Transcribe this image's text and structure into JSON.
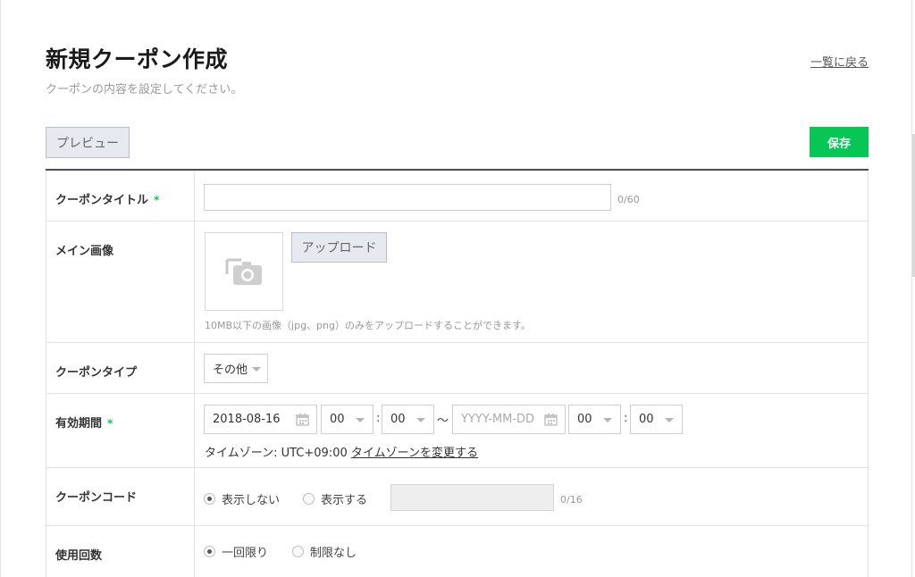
{
  "header": {
    "title": "新規クーポン作成",
    "subtitle": "クーポンの内容を設定してください。",
    "back_link": "一覧に戻る"
  },
  "toolbar": {
    "preview_label": "プレビュー",
    "save_label": "保存"
  },
  "form": {
    "title_row": {
      "label": "クーポンタイトル",
      "required_mark": "*",
      "value": "",
      "counter": "0/60"
    },
    "image_row": {
      "label": "メイン画像",
      "upload_label": "アップロード",
      "note": "10MB以下の画像（jpg、png）のみをアップロードすることができます。",
      "icon": "camera-icon"
    },
    "type_row": {
      "label": "クーポンタイプ",
      "selected": "その他"
    },
    "period_row": {
      "label": "有効期間",
      "required_mark": "*",
      "start_date": "2018-08-16",
      "start_hour": "00",
      "start_minute": "00",
      "colon": ":",
      "tilde": "〜",
      "end_date_placeholder": "YYYY-MM-DD",
      "end_hour": "00",
      "end_minute": "00",
      "timezone_text": "タイムゾーン: UTC+09:00",
      "timezone_link": "タイムゾーンを変更する"
    },
    "code_row": {
      "label": "クーポンコード",
      "option_hide": "表示しない",
      "option_show": "表示する",
      "selected": "表示しない",
      "counter": "0/16"
    },
    "usage_row": {
      "label": "使用回数",
      "option_once": "一回限り",
      "option_unlimited": "制限なし",
      "selected": "一回限り"
    }
  },
  "colors": {
    "accent": "#06c755",
    "button_bg": "#e6e9f0",
    "table_top_border": "#4b4d52"
  }
}
